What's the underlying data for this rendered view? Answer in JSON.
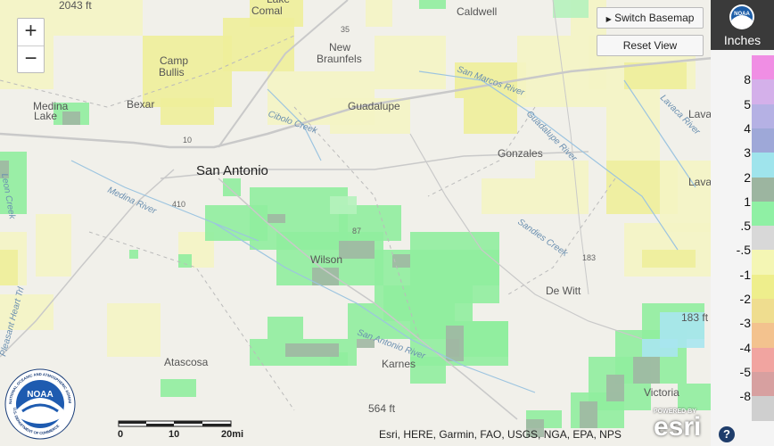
{
  "map": {
    "places": [
      {
        "name": "Comal",
        "cls": "place"
      },
      {
        "name": "Caldwell",
        "cls": "place"
      },
      {
        "name": "New",
        "cls": "place"
      },
      {
        "name": "Braunfels",
        "cls": "place"
      },
      {
        "name": "Camp",
        "cls": "place"
      },
      {
        "name": "Bullis",
        "cls": "place"
      },
      {
        "name": "Medina",
        "cls": "place"
      },
      {
        "name": "Lake",
        "cls": "place"
      },
      {
        "name": "Bexar",
        "cls": "place"
      },
      {
        "name": "Guadalupe",
        "cls": "place"
      },
      {
        "name": "San Antonio",
        "cls": "place-big"
      },
      {
        "name": "Gonzales",
        "cls": "place"
      },
      {
        "name": "Lavaca",
        "cls": "place"
      },
      {
        "name": "Lava",
        "cls": "place"
      },
      {
        "name": "Wilson",
        "cls": "place"
      },
      {
        "name": "De Witt",
        "cls": "place"
      },
      {
        "name": "Atascosa",
        "cls": "place"
      },
      {
        "name": "Karnes",
        "cls": "place"
      },
      {
        "name": "Victoria",
        "cls": "place"
      },
      {
        "name": "2043 ft",
        "cls": "place"
      },
      {
        "name": "183 ft",
        "cls": "place"
      },
      {
        "name": "564 ft",
        "cls": "place"
      },
      {
        "name": "Lake",
        "cls": "place"
      }
    ],
    "rivers": [
      "San Marcos River",
      "Cibolo Creek",
      "Guadalupe River",
      "Lavaca River",
      "Medina River",
      "Sandies Creek",
      "San Antonio River",
      "Pleasant Heart Trl",
      "Leon Creek"
    ],
    "roads": [
      "35",
      "10",
      "410",
      "87",
      "183"
    ]
  },
  "controls": {
    "zoom_in": "+",
    "zoom_out": "−",
    "switch_basemap": "Switch Basemap",
    "reset_view": "Reset View"
  },
  "legend": {
    "title": "Inches",
    "logo_text": "NOAA",
    "items": [
      {
        "label": "8",
        "color": "#f08ee4"
      },
      {
        "label": "5",
        "color": "#d4b0ea"
      },
      {
        "label": "4",
        "color": "#b5b1e4"
      },
      {
        "label": "3",
        "color": "#9ea8d8"
      },
      {
        "label": "2",
        "color": "#9fe4ec"
      },
      {
        "label": "1",
        "color": "#9cb5a0"
      },
      {
        "label": ".5",
        "color": "#8ff0a4"
      },
      {
        "label": "-.5",
        "color": "#d8d8d8"
      },
      {
        "label": "-1",
        "color": "#f4f6b4"
      },
      {
        "label": "-2",
        "color": "#eeee8c"
      },
      {
        "label": "-3",
        "color": "#efdd8f"
      },
      {
        "label": "-4",
        "color": "#f3c28e"
      },
      {
        "label": "-5",
        "color": "#f1a4a0"
      },
      {
        "label": "-8",
        "color": "#d7a0a0"
      },
      {
        "label": "",
        "color": "#cfcfcf"
      }
    ]
  },
  "scale": {
    "t0": "0",
    "t1": "10",
    "t2": "20mi"
  },
  "attribution": "Esri, HERE, Garmin, FAO, USGS, NGA, EPA, NPS",
  "esri": {
    "powered": "POWERED BY",
    "brand": "esri"
  },
  "help": "?",
  "noaa_logo": {
    "top": "NATIONAL OCEANIC AND ATMOSPHERIC ADMINISTRATION",
    "bottom": "U.S. DEPARTMENT OF COMMERCE",
    "center": "NOAA"
  }
}
